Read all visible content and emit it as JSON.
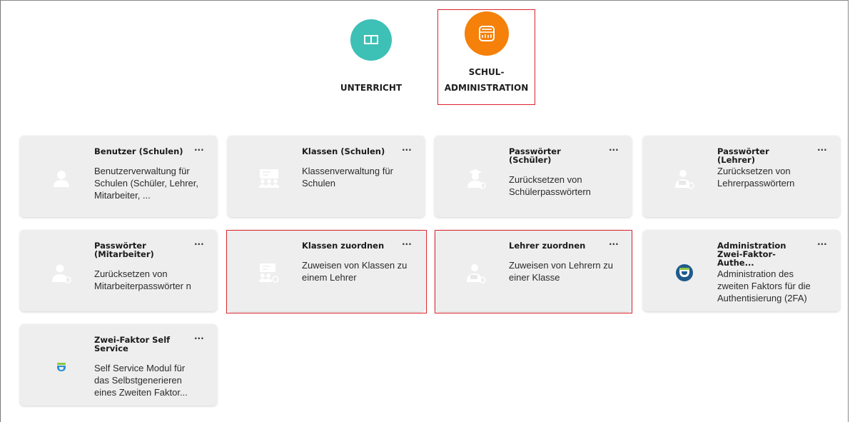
{
  "categories": [
    {
      "label": "UNTERRICHT",
      "icon": "book-icon",
      "color": "#3dc0b6"
    },
    {
      "label_line1": "SCHUL-",
      "label_line2": "ADMINISTRATION",
      "icon": "admin-icon",
      "color": "#f5800a",
      "selected": true
    }
  ],
  "tiles": [
    {
      "title": "Benutzer (Schulen)",
      "desc": "Benutzerverwaltung für Schulen (Schüler, Lehrer, Mitarbeiter, ...",
      "icon": "user-icon",
      "menu": "···"
    },
    {
      "title": "Klassen (Schulen)",
      "desc": "Klassenverwaltung für Schulen",
      "icon": "class-icon",
      "menu": "···"
    },
    {
      "title": "Passwörter (Schüler)",
      "desc": "Zurücksetzen von Schülerpasswörtern",
      "icon": "student-password-icon",
      "menu": "···"
    },
    {
      "title": "Passwörter (Lehrer)",
      "desc": "Zurücksetzen von Lehrerpasswörtern",
      "icon": "teacher-password-icon",
      "menu": "···"
    },
    {
      "title": "Passwörter (Mitarbeiter)",
      "desc": "Zurücksetzen von Mitarbeiterpasswörter n",
      "icon": "staff-password-icon",
      "menu": "···"
    },
    {
      "title": "Klassen zuordnen",
      "desc": "Zuweisen von Klassen zu einem Lehrer",
      "icon": "assign-class-icon",
      "menu": "···",
      "highlighted": true
    },
    {
      "title": "Lehrer zuordnen",
      "desc": "Zuweisen von Lehrern zu einer Klasse",
      "icon": "assign-teacher-icon",
      "menu": "···",
      "highlighted": true
    },
    {
      "title": "Administration Zwei-Faktor-Authe...",
      "desc": "Administration des zweiten Faktors für die Authentisierung (2FA)",
      "icon": "2fa-admin-icon",
      "menu": "···"
    },
    {
      "title": "Zwei-Faktor Self Service",
      "desc": "Self Service Modul für das Selbstgenerieren eines Zweiten Faktor...",
      "icon": "2fa-self-service-icon",
      "menu": "···"
    }
  ],
  "colors": {
    "tile_bg": "#eeeeee",
    "icon_white": "#ffffff",
    "highlight": "#d9232c",
    "teal": "#3dc0b6",
    "orange": "#f5800a",
    "privacyidea_blue": "#1f5a8c"
  }
}
